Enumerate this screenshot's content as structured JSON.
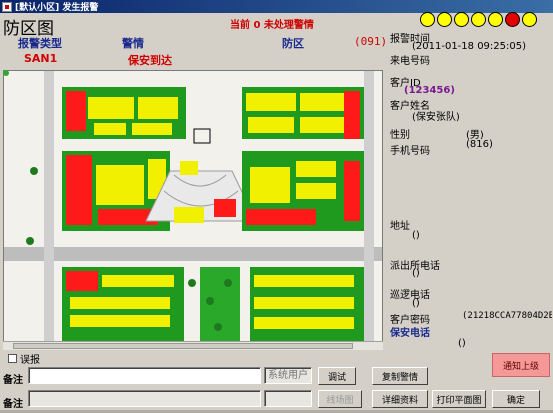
{
  "window": {
    "title": "[默认小区] 发生报警"
  },
  "panel": {
    "title": "防区图",
    "pending_text": "当前 0 未处理警情"
  },
  "lamps": [
    "yellow",
    "yellow",
    "yellow",
    "yellow",
    "yellow",
    "red",
    "yellow"
  ],
  "header": {
    "alarm_type_label": "报警类型",
    "alarm_type_value": "SAN1",
    "event_label": "警情",
    "event_value": "保安到达",
    "zone_label": "防区",
    "zone_code": "(091)"
  },
  "info": {
    "alarm_time_label": "报警时间",
    "alarm_time_value": "(2011-01-18 09:25:05)",
    "caller_label": "来电号码",
    "customer_id_label": "客户ID",
    "customer_id_value": "(123456)",
    "customer_name_label": "客户姓名",
    "customer_name_value": "(保安张队)",
    "gender_label": "性别",
    "gender_value": "(男)",
    "mobile_label": "手机号码",
    "mobile_value": "(816)",
    "address_label": "地址",
    "address_value": "()",
    "police_phone_label": "派出所电话",
    "police_phone_value": "()",
    "patrol_phone_label": "巡逻电话",
    "patrol_phone_value": "()",
    "password_label": "客户密码",
    "password_value": "(21218CCA77804D2B",
    "security_phone_label": "保安电话",
    "security_phone_value": "()"
  },
  "checkbox": {
    "label": "误报"
  },
  "remark1": {
    "label": "备注",
    "value": "",
    "system_user_placeholder": "系统用户"
  },
  "remark2": {
    "label": "备注",
    "value": ""
  },
  "buttons": {
    "debug": "调试",
    "copy_alarm": "复制警情",
    "map": "线场图",
    "detail": "详细资料",
    "print_plan": "打印平面图",
    "confirm": "确定",
    "notify": "通知上级"
  },
  "colors": {
    "building_yellow": "#f0f000",
    "building_red": "#ff1a1a",
    "lawn_green": "#1f9a1f",
    "road": "#bdbdbd"
  }
}
